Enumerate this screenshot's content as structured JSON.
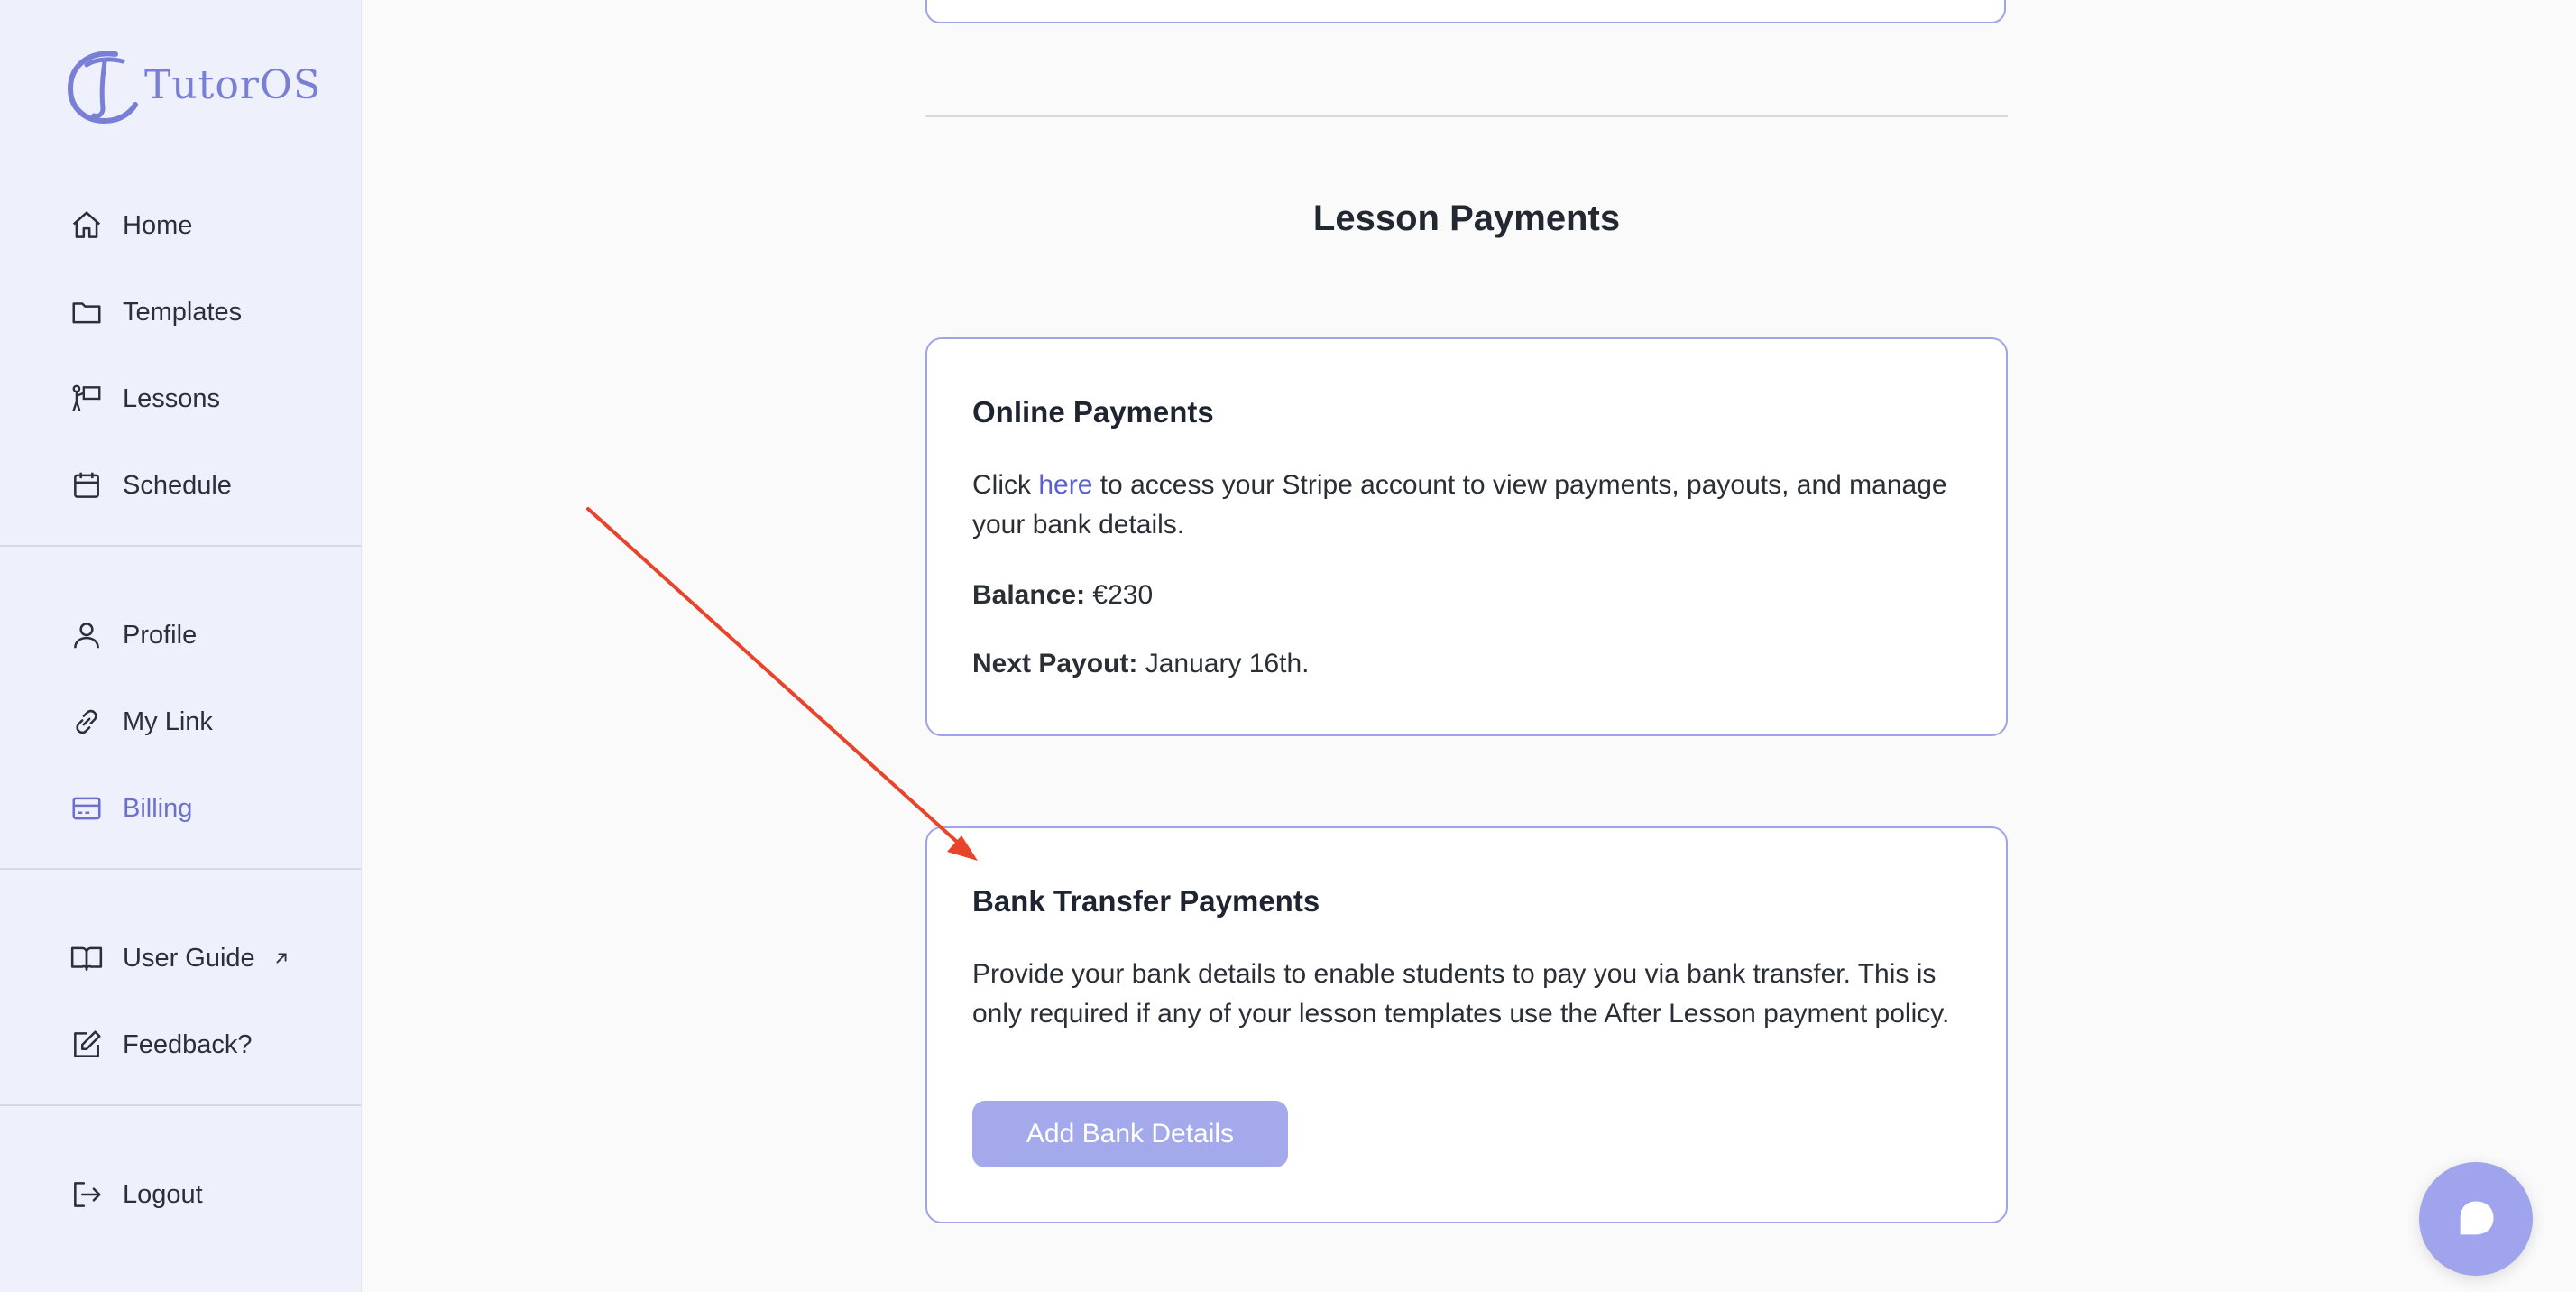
{
  "app": {
    "name": "TutorOS",
    "accent": "#6a6fd0",
    "button_color": "#a4a9ec",
    "border_color": "#9ea4e6"
  },
  "sidebar": {
    "primary": [
      {
        "label": "Home",
        "icon": "home-icon"
      },
      {
        "label": "Templates",
        "icon": "folder-icon"
      },
      {
        "label": "Lessons",
        "icon": "teacher-board-icon"
      },
      {
        "label": "Schedule",
        "icon": "calendar-icon"
      }
    ],
    "account": [
      {
        "label": "Profile",
        "icon": "user-icon"
      },
      {
        "label": "My Link",
        "icon": "link-icon"
      },
      {
        "label": "Billing",
        "icon": "credit-card-icon",
        "active": true
      }
    ],
    "help": [
      {
        "label": "User Guide",
        "icon": "book-icon",
        "external": true
      },
      {
        "label": "Feedback?",
        "icon": "edit-icon"
      }
    ],
    "logout": {
      "label": "Logout",
      "icon": "logout-icon"
    }
  },
  "main": {
    "section_title": "Lesson Payments",
    "online": {
      "title": "Online Payments",
      "text_before": "Click ",
      "link_text": "here",
      "text_after": " to access your Stripe account to view payments, payouts, and manage your bank details.",
      "balance_label": "Balance:",
      "balance_value": "€230",
      "payout_label": "Next Payout:",
      "payout_value": "January 16th."
    },
    "bank": {
      "title": "Bank Transfer Payments",
      "text": "Provide your bank details to enable students to pay you via bank transfer. This is only required if any of your lesson templates use the After Lesson payment policy.",
      "button_label": "Add Bank Details"
    }
  },
  "annotation": {
    "type": "arrow",
    "color": "#e8442c"
  },
  "chat": {
    "icon": "chat-bubble-icon"
  }
}
